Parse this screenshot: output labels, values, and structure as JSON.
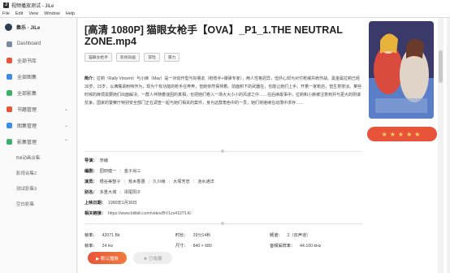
{
  "window": {
    "title": "视频播放测试 - JiLe"
  },
  "menu": [
    "File",
    "Edit",
    "View",
    "Window",
    "Help"
  ],
  "sidebar": {
    "user": "集乐 · JiLe",
    "items": [
      {
        "label": "Dashboard",
        "icon": "dashboard-icon",
        "color": "#7a8aa0"
      },
      {
        "label": "全部书库",
        "icon": "book-icon",
        "color": "#e8543a"
      },
      {
        "label": "全部图集",
        "icon": "image-icon",
        "color": "#3a8ee8"
      },
      {
        "label": "全部影集",
        "icon": "video-icon",
        "color": "#3ab06a"
      },
      {
        "label": "书籍管理",
        "icon": "book-manage-icon",
        "color": "#e8543a",
        "chevron": "⌄"
      },
      {
        "label": "图集管理",
        "icon": "image-manage-icon",
        "color": "#3a8ee8",
        "chevron": "⌄"
      },
      {
        "label": "影集管理",
        "icon": "video-manage-icon",
        "color": "#3ab06a",
        "chevron": "⌃"
      }
    ],
    "subitems": [
      "Bili动画合集",
      "影视合集2",
      "测试影集3",
      "空白影集"
    ]
  },
  "detail": {
    "title": "[高清 1080P] 猫眼女枪手【OVA】_P1_1.THE NEUTRAL ZONE.mp4",
    "tags": [
      "猫眼女枪手",
      "影视动画",
      "冒险",
      "暴力"
    ],
    "intro_label": "简介：",
    "intro": "拉莉（Rally Vincent）与小麻（May）是一对动作型与好朋友（枪枝手+爆弹专家），两人性格迥异，但外心却为对付枪械并肩作战。黑金属拉莉已经30岁，15岁，以满嘴讽刺呐作为，现为个有功能的枪手在奔奔，但她依然保持着。前面积下的武器在，也能让她们上手。开着一家枪店，但生意惨淡。某些时候的麻烦需要她们出面解决。一群人伴随着谜团的真相，也把她们卷入一场大大小小的风波之中……在后续故事中，拉莉和小麻被注意到并与更大的阴谋抗争。国家的警察厅特别安全部门正在调查一起与她们相关的案件，身为这群角色中的一员，她们将继续在动荡中求存……",
    "fields": [
      {
        "label": "导演：",
        "values": [
          "奈緒"
        ]
      },
      {
        "label": "编剧：",
        "values": [
          "园田健一",
          "金子尚三"
        ]
      },
      {
        "label": "演员：",
        "values": [
          "根谷美智子",
          "荒木香惠",
          "久川绫",
          "大塚芳忠",
          "池水通洋"
        ]
      },
      {
        "label": "别名：",
        "values": [
          "多重大城",
          "泽尾阳子"
        ]
      },
      {
        "label": "上映日期：",
        "values": [
          "1990年1月30日"
        ]
      },
      {
        "label": "相关链接：",
        "values": [
          "https://www.bilibili.com/video/BV1zs411f7LK/"
        ]
      }
    ],
    "stats": [
      {
        "label": "帧率：",
        "value": "42071 Bit"
      },
      {
        "label": "时长：",
        "value": "29分14秒"
      },
      {
        "label": "频道：",
        "value": "2（双声道）"
      },
      {
        "label": "帧率：",
        "value": "24 Hz"
      },
      {
        "label": "尺寸：",
        "value": "840 × 680"
      },
      {
        "label": "音频采样率：",
        "value": "44.100 kHz"
      }
    ],
    "rating_stars": "★★★★★",
    "play_label": "▶ 默认播放",
    "fav_label": "★ 已收藏"
  },
  "colors": {
    "accent": "#e8543a"
  }
}
